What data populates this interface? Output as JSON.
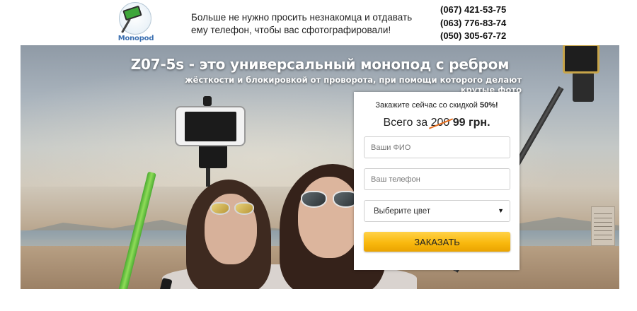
{
  "header": {
    "logo_text": "Monopod",
    "tagline": "Больше не нужно просить незнакомца и отдавать ему телефон, чтобы вас сфотографировали!",
    "phones": [
      "(067) 421-53-75",
      "(063) 776-83-74",
      "(050) 305-67-72"
    ]
  },
  "hero": {
    "headline": "Z07-5s - это универсальный монопод с ребром",
    "subheadline": "жёсткости и блокировкой от проворота, при помощи которого делают крутые фото"
  },
  "order_form": {
    "offer_prefix": "Закажите сейчас со скидкой",
    "discount": "50%!",
    "price_prefix": "Всего за",
    "old_price": "200",
    "new_price": "99 грн.",
    "name_placeholder": "Ваши ФИО",
    "phone_placeholder": "Ваш телефон",
    "color_select_value": "Выберите цвет",
    "submit_label": "ЗАКАЗАТЬ"
  },
  "colors": {
    "button": "#f9b90e",
    "price_strike": "#e36b1c",
    "logo_text": "#3b6fb0"
  }
}
